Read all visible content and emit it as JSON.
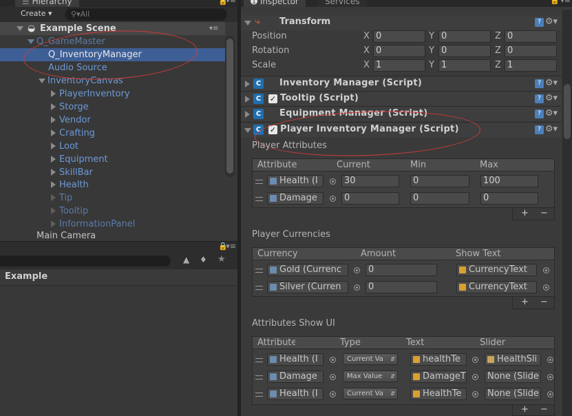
{
  "hierarchy": {
    "tab_label": "Hierarchy",
    "create_label": "Create",
    "search_placeholder": "All",
    "scene_name": "Example Scene",
    "items": [
      {
        "label": "Q_GameMaster",
        "style": "prefab-dim"
      },
      {
        "label": "Q_InventoryManager",
        "style": "selected"
      },
      {
        "label": "Audio Source",
        "style": "blue"
      },
      {
        "label": "InventoryCanvas",
        "style": "blue"
      },
      {
        "label": "PlayerInventory",
        "style": "blue"
      },
      {
        "label": "Storge",
        "style": "blue"
      },
      {
        "label": "Vendor",
        "style": "blue"
      },
      {
        "label": "Crafting",
        "style": "blue"
      },
      {
        "label": "Loot",
        "style": "blue"
      },
      {
        "label": "Equipment",
        "style": "blue"
      },
      {
        "label": "SkillBar",
        "style": "blue"
      },
      {
        "label": "Health",
        "style": "blue"
      },
      {
        "label": "Tip",
        "style": "dim"
      },
      {
        "label": "Tooltip",
        "style": "dim"
      },
      {
        "label": "InformationPanel",
        "style": "dim"
      },
      {
        "label": "Main Camera",
        "style": "normal"
      }
    ]
  },
  "project": {
    "folder_label": "Example"
  },
  "inspector": {
    "tab_inspector": "Inspector",
    "tab_services": "Services",
    "transform": {
      "title": "Transform",
      "rows": [
        {
          "label": "Position",
          "x": "0",
          "y": "0",
          "z": "0"
        },
        {
          "label": "Rotation",
          "x": "0",
          "y": "0",
          "z": "0"
        },
        {
          "label": "Scale",
          "x": "1",
          "y": "1",
          "z": "1"
        }
      ],
      "axis_x": "X",
      "axis_y": "Y",
      "axis_z": "Z"
    },
    "components": [
      {
        "title": "Inventory Manager (Script)"
      },
      {
        "title": "Tooltip (Script)"
      },
      {
        "title": "Equipment Manager (Script)"
      },
      {
        "title": "Player Inventory Manager (Script)"
      }
    ],
    "player_attributes": {
      "label": "Player Attributes",
      "headers": [
        "Attribute",
        "Current",
        "Min",
        "Max"
      ],
      "rows": [
        {
          "attribute": "Health (I",
          "current": "30",
          "min": "0",
          "max": "100"
        },
        {
          "attribute": "Damage",
          "current": "0",
          "min": "0",
          "max": "0"
        }
      ]
    },
    "player_currencies": {
      "label": "Player Currencies",
      "headers": [
        "Currency",
        "Amount",
        "Show Text"
      ],
      "rows": [
        {
          "currency": "Gold (Currenc",
          "amount": "0",
          "show_text": "CurrencyText"
        },
        {
          "currency": "Silver (Curren",
          "amount": "0",
          "show_text": "CurrencyText"
        }
      ]
    },
    "attributes_show_ui": {
      "label": "Attributes Show UI",
      "headers": [
        "Attribute",
        "Type",
        "Text",
        "Slider"
      ],
      "rows": [
        {
          "attribute": "Health (I",
          "type": "Current Va",
          "text": "healthTe",
          "slider": "HealthSli"
        },
        {
          "attribute": "Damage",
          "type": "Max Value",
          "text": "DamageT",
          "slider": "None (Slide"
        },
        {
          "attribute": "Health (I",
          "type": "Current Va",
          "text": "HealthTe",
          "slider": "None (Slide"
        }
      ]
    },
    "plus": "+",
    "minus": "−"
  },
  "colors": {
    "annotation_red": "#d23a3a",
    "selection_blue": "#3e5f96",
    "prefab_blue": "#6c9ad8"
  }
}
